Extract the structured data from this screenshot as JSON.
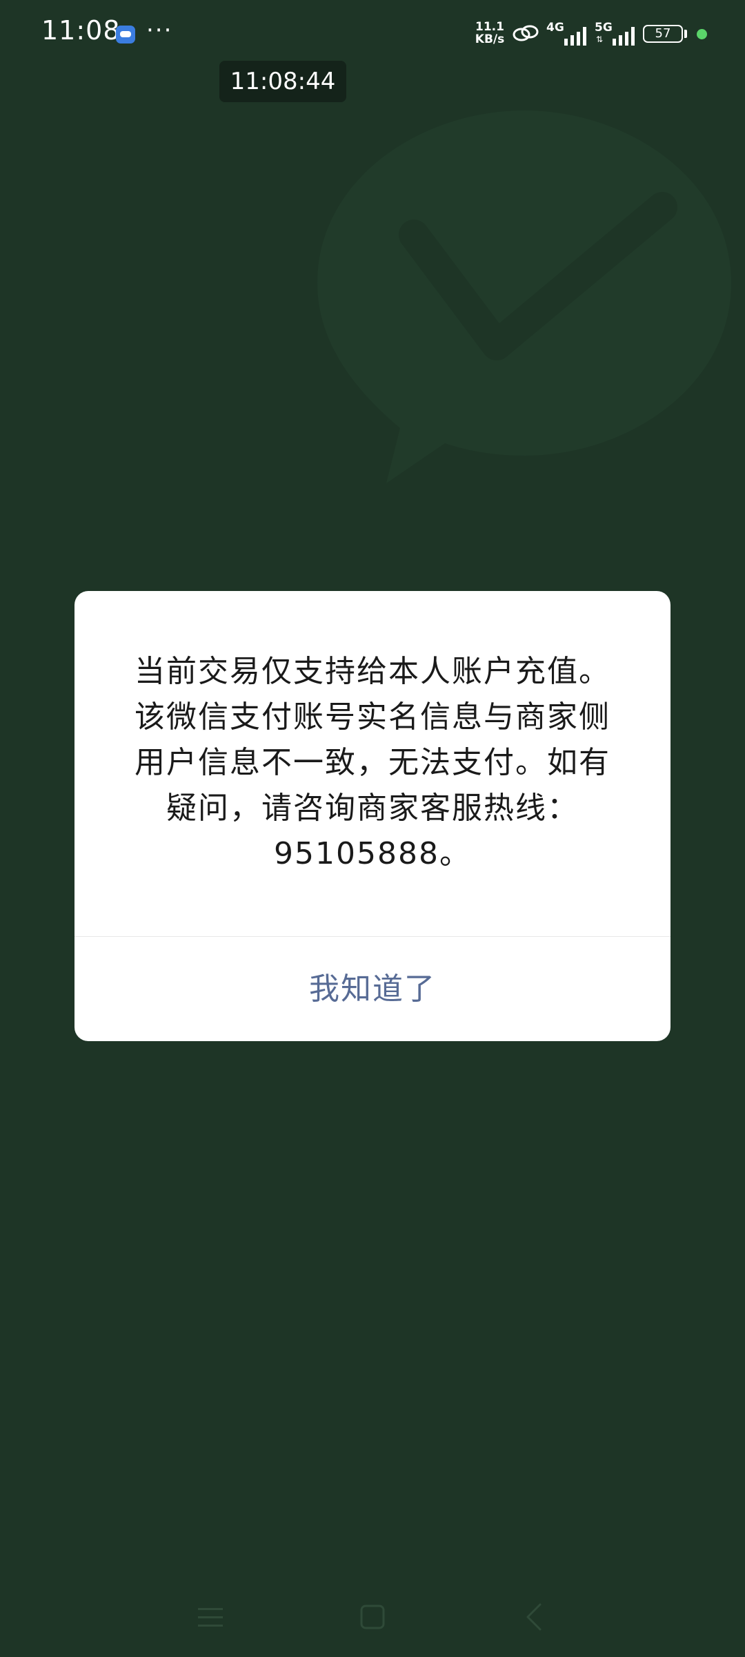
{
  "status_bar": {
    "time": "11:08",
    "more": "···",
    "net_speed_value": "11.1",
    "net_speed_unit": "KB/s",
    "signal_1_label": "4G",
    "signal_2_label": "5G",
    "battery": "57",
    "icons": [
      "message-icon",
      "link-icon",
      "signal-icon",
      "battery-icon"
    ]
  },
  "floating_clock": "11:08:44",
  "dialog": {
    "message": "当前交易仅支持给本人账户充值。该微信支付账号实名信息与商家侧用户信息不一致，无法支付。如有疑问，请咨询商家客服热线：95105888。",
    "button_label": "我知道了",
    "button_color": "#576b95"
  },
  "nav_bar": {
    "icons": [
      "menu-icon",
      "home-icon",
      "back-icon"
    ]
  },
  "colors": {
    "background": "#1e3526",
    "dialog_bg": "#ffffff",
    "status_dot": "#5bd46a"
  }
}
